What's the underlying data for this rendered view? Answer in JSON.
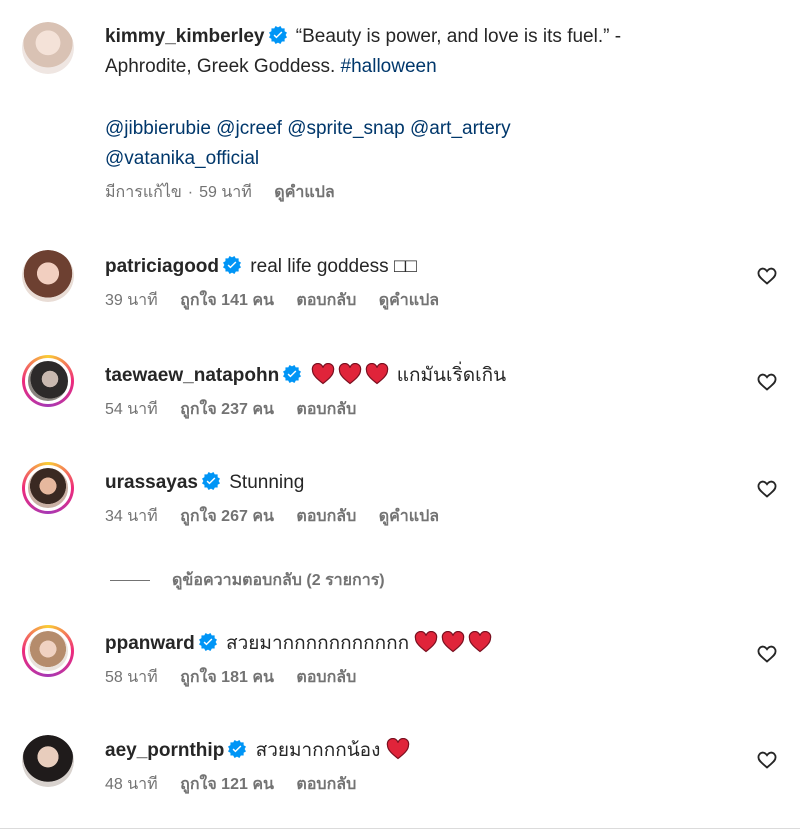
{
  "caption": {
    "username": "kimmy_kimberley",
    "text_line1": "“Beauty is power, and love is its fuel.” -",
    "text_line2_plain": "Aphrodite, Greek Goddess. ",
    "hashtag": "#halloween",
    "mentions_line1": "@jibbierubie @jcreef @sprite_snap @art_artery",
    "mentions_line2": "@vatanika_official",
    "edited": "มีการแก้ไข",
    "sep": "·",
    "time": "59 นาที",
    "translate": "ดูคำแปล"
  },
  "comments": [
    {
      "username": "patriciagood",
      "text": "real life goddess □□",
      "time": "39 นาที",
      "likes": "ถูกใจ 141 คน",
      "reply": "ตอบกลับ",
      "translate": "ดูคำแปล"
    },
    {
      "username": "taewaew_natapohn",
      "text": "แกมันเริ่ดเกิน",
      "hearts": 3,
      "time": "54 นาที",
      "likes": "ถูกใจ 237 คน",
      "reply": "ตอบกลับ"
    },
    {
      "username": "urassayas",
      "text": "Stunning",
      "time": "34 นาที",
      "likes": "ถูกใจ 267 คน",
      "reply": "ตอบกลับ",
      "translate": "ดูคำแปล"
    },
    {
      "username": "ppanward",
      "text": "สวยมากกกกกกกกกกก",
      "hearts": 3,
      "time": "58 นาที",
      "likes": "ถูกใจ 181 คน",
      "reply": "ตอบกลับ"
    },
    {
      "username": "aey_pornthip",
      "text": "สวยมากกกน้อง",
      "hearts": 1,
      "time": "48 นาที",
      "likes": "ถูกใจ 121 คน",
      "reply": "ตอบกลับ"
    }
  ],
  "view_replies": "ดูข้อความตอบกลับ (2 รายการ)",
  "colors": {
    "verified": "#0095f6",
    "heart_emoji": "#e0243a",
    "link": "#00376b",
    "meta": "#737373"
  },
  "icons": {
    "verified": "verified-badge-icon",
    "like": "heart-outline-icon"
  }
}
